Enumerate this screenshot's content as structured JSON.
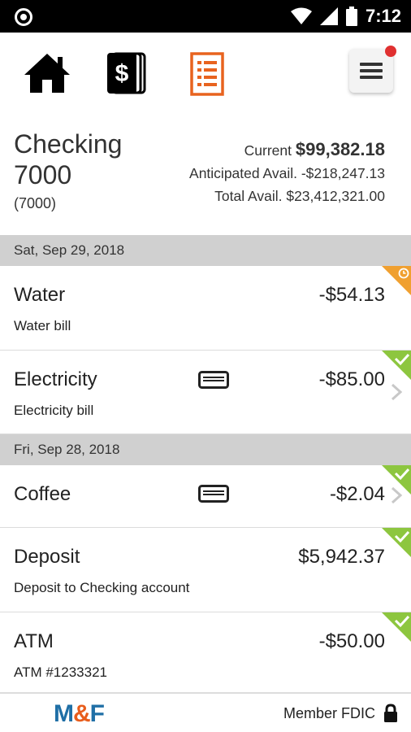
{
  "status_bar": {
    "time": "7:12"
  },
  "nav": {
    "icons": [
      "home-icon",
      "dollar-cards-icon",
      "document-list-icon",
      "hamburger-menu-icon"
    ],
    "active_color": "#e8631f"
  },
  "account": {
    "name": "Checking 7000",
    "number": "(7000)",
    "current_label": "Current",
    "current_value": "$99,382.18",
    "anticipated": "Anticipated Avail. -$218,247.13",
    "total": "Total Avail. $23,412,321.00"
  },
  "groups": [
    {
      "date": "Sat, Sep 29, 2018",
      "transactions": [
        {
          "name": "Water",
          "description": "Water bill",
          "amount": "-$54.13",
          "status": "pending"
        },
        {
          "name": "Electricity",
          "description": "Electricity bill",
          "amount": "-$85.00",
          "status": "cleared"
        }
      ]
    },
    {
      "date": "Fri, Sep 28, 2018",
      "transactions": [
        {
          "name": "Coffee",
          "description": "",
          "amount": "-$2.04",
          "status": "cleared"
        },
        {
          "name": "Deposit",
          "description": "Deposit to Checking account",
          "amount": "$5,942.37",
          "status": "cleared"
        },
        {
          "name": "ATM",
          "description": "ATM #1233321",
          "amount": "-$50.00",
          "status": "cleared"
        }
      ]
    }
  ],
  "footer": {
    "logo_left": "M",
    "logo_amp": "&",
    "logo_right": "F",
    "member": "Member FDIC"
  },
  "colors": {
    "pending": "#f0a030",
    "cleared": "#8dc63f",
    "brand_blue": "#1f6fa6",
    "brand_orange": "#e85d1c"
  }
}
